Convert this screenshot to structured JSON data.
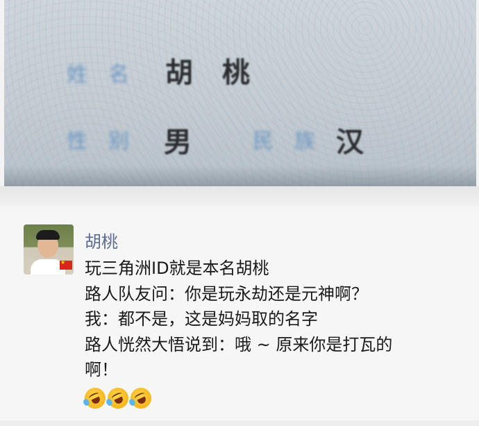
{
  "id_card": {
    "name_label": "姓名",
    "name_value": "胡桃",
    "sex_label": "性别",
    "sex_value": "男",
    "ethnicity_label": "民族",
    "ethnicity_value": "汉"
  },
  "post": {
    "author": "胡桃",
    "lines": [
      "玩三角洲ID就是本名胡桃",
      "路人队友问：你是玩永劫还是元神啊？",
      "我：都不是，这是妈妈取的名字",
      "路人恍然大悟说到：哦 ~ 原来你是打瓦的",
      "啊！"
    ],
    "emojis": [
      "rofl-emoji",
      "rofl-emoji",
      "rofl-emoji"
    ]
  }
}
